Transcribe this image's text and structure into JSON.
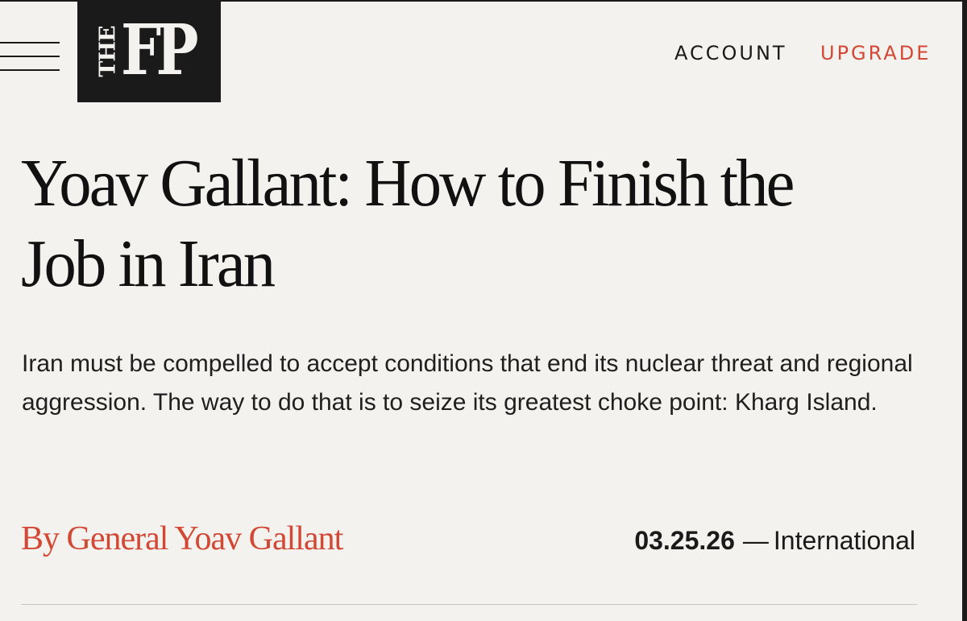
{
  "header": {
    "logo_the": "THE",
    "logo_fp": "FP",
    "account_label": "ACCOUNT",
    "upgrade_label": "UPGRADE"
  },
  "icons": {
    "menu": "hamburger-menu-icon"
  },
  "colors": {
    "background": "#f3f2ef",
    "accent_red": "#d24834",
    "text_dark": "#1a1a1a",
    "logo_bg": "#1a1a1a"
  },
  "article": {
    "headline": "Yoav Gallant: How to Finish the Job in Iran",
    "dek": "Iran must be compelled to accept conditions that end its nuclear threat and regional aggression. The way to do that is to seize its greatest choke point: Kharg Island.",
    "byline": "By General Yoav Gallant",
    "date": "03.25.26",
    "dash": "—",
    "section": "International"
  }
}
